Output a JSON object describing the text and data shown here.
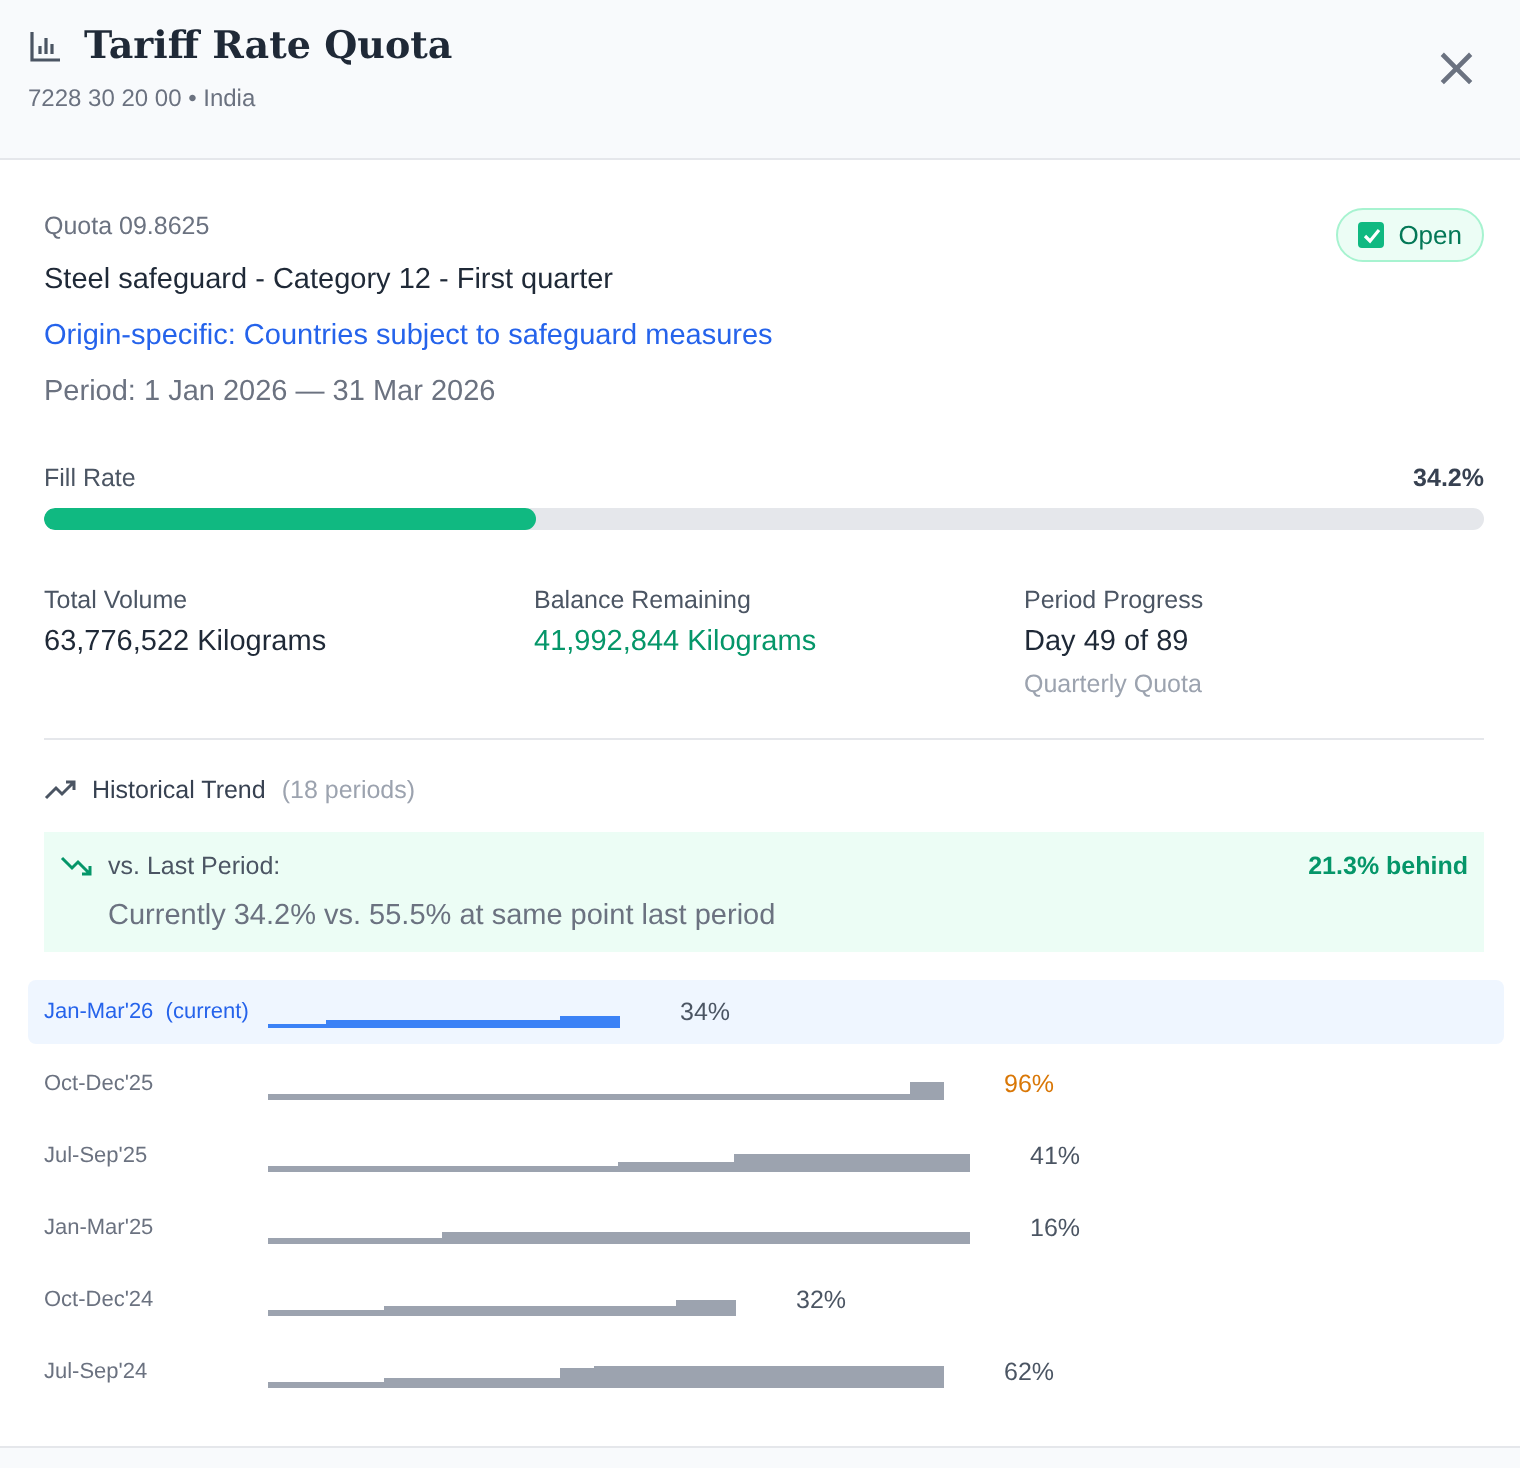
{
  "header": {
    "title": "Tariff Rate Quota",
    "subtitle": "7228 30 20 00 • India",
    "close": "×"
  },
  "quota": {
    "number": "Quota 09.8625",
    "name": "Steel safeguard - Category 12 - First quarter",
    "origin_link": "Origin-specific: Countries subject to safeguard measures",
    "period": "Period: 1 Jan 2026 — 31 Mar 2026",
    "status": {
      "label": "Open",
      "checked": true
    }
  },
  "fill_rate": {
    "label": "Fill Rate",
    "value": "34.2%",
    "level": 0.342
  },
  "stats": [
    {
      "label": "Total Volume",
      "value": "63,776,522 Kilograms",
      "kind": "plain"
    },
    {
      "label": "Balance Remaining",
      "value": "41,992,844 Kilograms",
      "kind": "positive"
    },
    {
      "label": "Period Progress",
      "value": "Day 49 of 89",
      "note": "Quarterly Quota",
      "kind": "plain"
    }
  ],
  "trend": {
    "title": "Historical Trend",
    "count": "(18 periods)",
    "comparison": {
      "label": "vs. Last Period:",
      "result": "21.3% behind",
      "detail": "Currently 34.2% vs. 55.5% at same point last period"
    }
  },
  "periods": [
    {
      "label": "Jan-Mar'26",
      "tag": "(current)",
      "percent": "34%",
      "selected": true,
      "kind": "normal"
    },
    {
      "label": "Oct-Dec'25",
      "percent": "96%",
      "selected": false,
      "kind": "warning"
    },
    {
      "label": "Jul-Sep'25",
      "percent": "41%",
      "selected": false,
      "kind": "normal"
    },
    {
      "label": "Jan-Mar'25",
      "percent": "16%",
      "selected": false,
      "kind": "normal"
    },
    {
      "label": "Oct-Dec'24",
      "percent": "32%",
      "selected": false,
      "kind": "normal"
    },
    {
      "label": "Jul-Sep'24",
      "percent": "62%",
      "selected": false,
      "kind": "normal"
    }
  ]
}
